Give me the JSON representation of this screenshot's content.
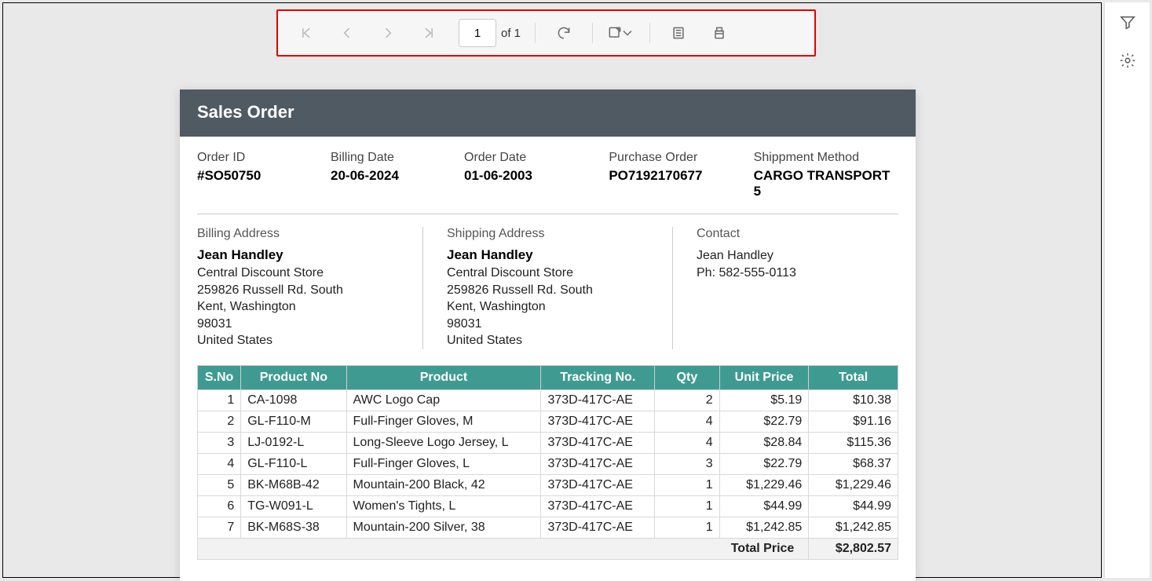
{
  "toolbar": {
    "page_value": "1",
    "of_label": "of 1"
  },
  "rail": {
    "filter_icon": "filter",
    "settings_icon": "gear"
  },
  "report": {
    "title": "Sales Order",
    "meta": {
      "order_id_label": "Order ID",
      "order_id": "#SO50750",
      "billing_date_label": "Billing Date",
      "billing_date": "20-06-2024",
      "order_date_label": "Order Date",
      "order_date": "01-06-2003",
      "po_label": "Purchase Order",
      "po": "PO7192170677",
      "ship_method_label": "Shippment Method",
      "ship_method": "CARGO TRANSPORT 5"
    },
    "billing": {
      "title": "Billing Address",
      "name": "Jean Handley",
      "company": "Central Discount Store",
      "street": "259826 Russell Rd. South",
      "city": "Kent, Washington",
      "zip": "98031",
      "country": "United States"
    },
    "shipping": {
      "title": "Shipping Address",
      "name": "Jean Handley",
      "company": "Central Discount Store",
      "street": "259826 Russell Rd. South",
      "city": "Kent, Washington",
      "zip": "98031",
      "country": "United States"
    },
    "contact": {
      "title": "Contact",
      "name": "Jean Handley",
      "phone": "Ph: 582-555-0113"
    },
    "columns": {
      "sno": "S.No",
      "prodno": "Product No",
      "prod": "Product",
      "track": "Tracking No.",
      "qty": "Qty",
      "unit": "Unit Price",
      "total": "Total"
    },
    "rows": [
      {
        "sno": "1",
        "prodno": "CA-1098",
        "prod": "AWC Logo Cap",
        "track": "373D-417C-AE",
        "qty": "2",
        "unit": "$5.19",
        "total": "$10.38"
      },
      {
        "sno": "2",
        "prodno": "GL-F110-M",
        "prod": "Full-Finger Gloves, M",
        "track": "373D-417C-AE",
        "qty": "4",
        "unit": "$22.79",
        "total": "$91.16"
      },
      {
        "sno": "3",
        "prodno": "LJ-0192-L",
        "prod": "Long-Sleeve Logo Jersey, L",
        "track": "373D-417C-AE",
        "qty": "4",
        "unit": "$28.84",
        "total": "$115.36"
      },
      {
        "sno": "4",
        "prodno": "GL-F110-L",
        "prod": "Full-Finger Gloves, L",
        "track": "373D-417C-AE",
        "qty": "3",
        "unit": "$22.79",
        "total": "$68.37"
      },
      {
        "sno": "5",
        "prodno": "BK-M68B-42",
        "prod": "Mountain-200 Black, 42",
        "track": "373D-417C-AE",
        "qty": "1",
        "unit": "$1,229.46",
        "total": "$1,229.46"
      },
      {
        "sno": "6",
        "prodno": "TG-W091-L",
        "prod": "Women's Tights, L",
        "track": "373D-417C-AE",
        "qty": "1",
        "unit": "$44.99",
        "total": "$44.99"
      },
      {
        "sno": "7",
        "prodno": "BK-M68S-38",
        "prod": "Mountain-200 Silver, 38",
        "track": "373D-417C-AE",
        "qty": "1",
        "unit": "$1,242.85",
        "total": "$1,242.85"
      }
    ],
    "total_price_label": "Total Price",
    "total_price": "$2,802.57"
  }
}
